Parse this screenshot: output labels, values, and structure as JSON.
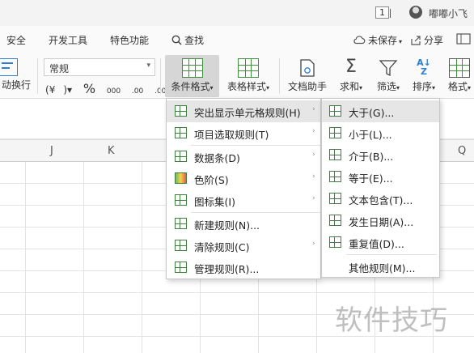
{
  "titlebar": {
    "page_badge": "1",
    "username": "嘟嘟小飞"
  },
  "menu_tabs": [
    {
      "label": "安全"
    },
    {
      "label": "开发工具"
    },
    {
      "label": "特色功能"
    },
    {
      "label": "查找"
    },
    {
      "label": "未保存"
    },
    {
      "label": "分享"
    }
  ],
  "ribbon": {
    "wrap_label": "动换行",
    "number_format": "常规",
    "currency_symbol": "¥",
    "percent_symbol": "%",
    "thousands_symbol": "000",
    "inc_decimal": ".00",
    "dec_decimal": ".00",
    "conditional_format": "条件格式",
    "table_style": "表格样式",
    "doc_helper": "文档助手",
    "sum": "求和",
    "filter": "筛选",
    "sort": "排序",
    "format": "格式"
  },
  "columns": [
    "J",
    "K",
    "Q"
  ],
  "cf_menu": [
    {
      "label": "突出显示单元格规则(H)",
      "icon": "highlight-rules-icon",
      "submenu": true
    },
    {
      "label": "项目选取规则(T)",
      "icon": "top-bottom-rules-icon",
      "submenu": true
    },
    {
      "label": "数据条(D)",
      "icon": "data-bars-icon",
      "submenu": true
    },
    {
      "label": "色阶(S)",
      "icon": "color-scales-icon",
      "submenu": true
    },
    {
      "label": "图标集(I)",
      "icon": "icon-sets-icon",
      "submenu": true
    },
    {
      "label": "新建规则(N)...",
      "icon": "new-rule-icon",
      "submenu": false
    },
    {
      "label": "清除规则(C)",
      "icon": "clear-rules-icon",
      "submenu": true
    },
    {
      "label": "管理规则(R)...",
      "icon": "manage-rules-icon",
      "submenu": false
    }
  ],
  "highlight_submenu": [
    {
      "label": "大于(G)...",
      "icon": "greater-than-icon"
    },
    {
      "label": "小于(L)...",
      "icon": "less-than-icon"
    },
    {
      "label": "介于(B)...",
      "icon": "between-icon"
    },
    {
      "label": "等于(E)...",
      "icon": "equal-to-icon"
    },
    {
      "label": "文本包含(T)...",
      "icon": "text-contains-icon"
    },
    {
      "label": "发生日期(A)...",
      "icon": "date-occurring-icon"
    },
    {
      "label": "重复值(D)...",
      "icon": "duplicate-values-icon"
    },
    {
      "label": "其他规则(M)...",
      "icon": ""
    }
  ],
  "watermark": "软件技巧"
}
